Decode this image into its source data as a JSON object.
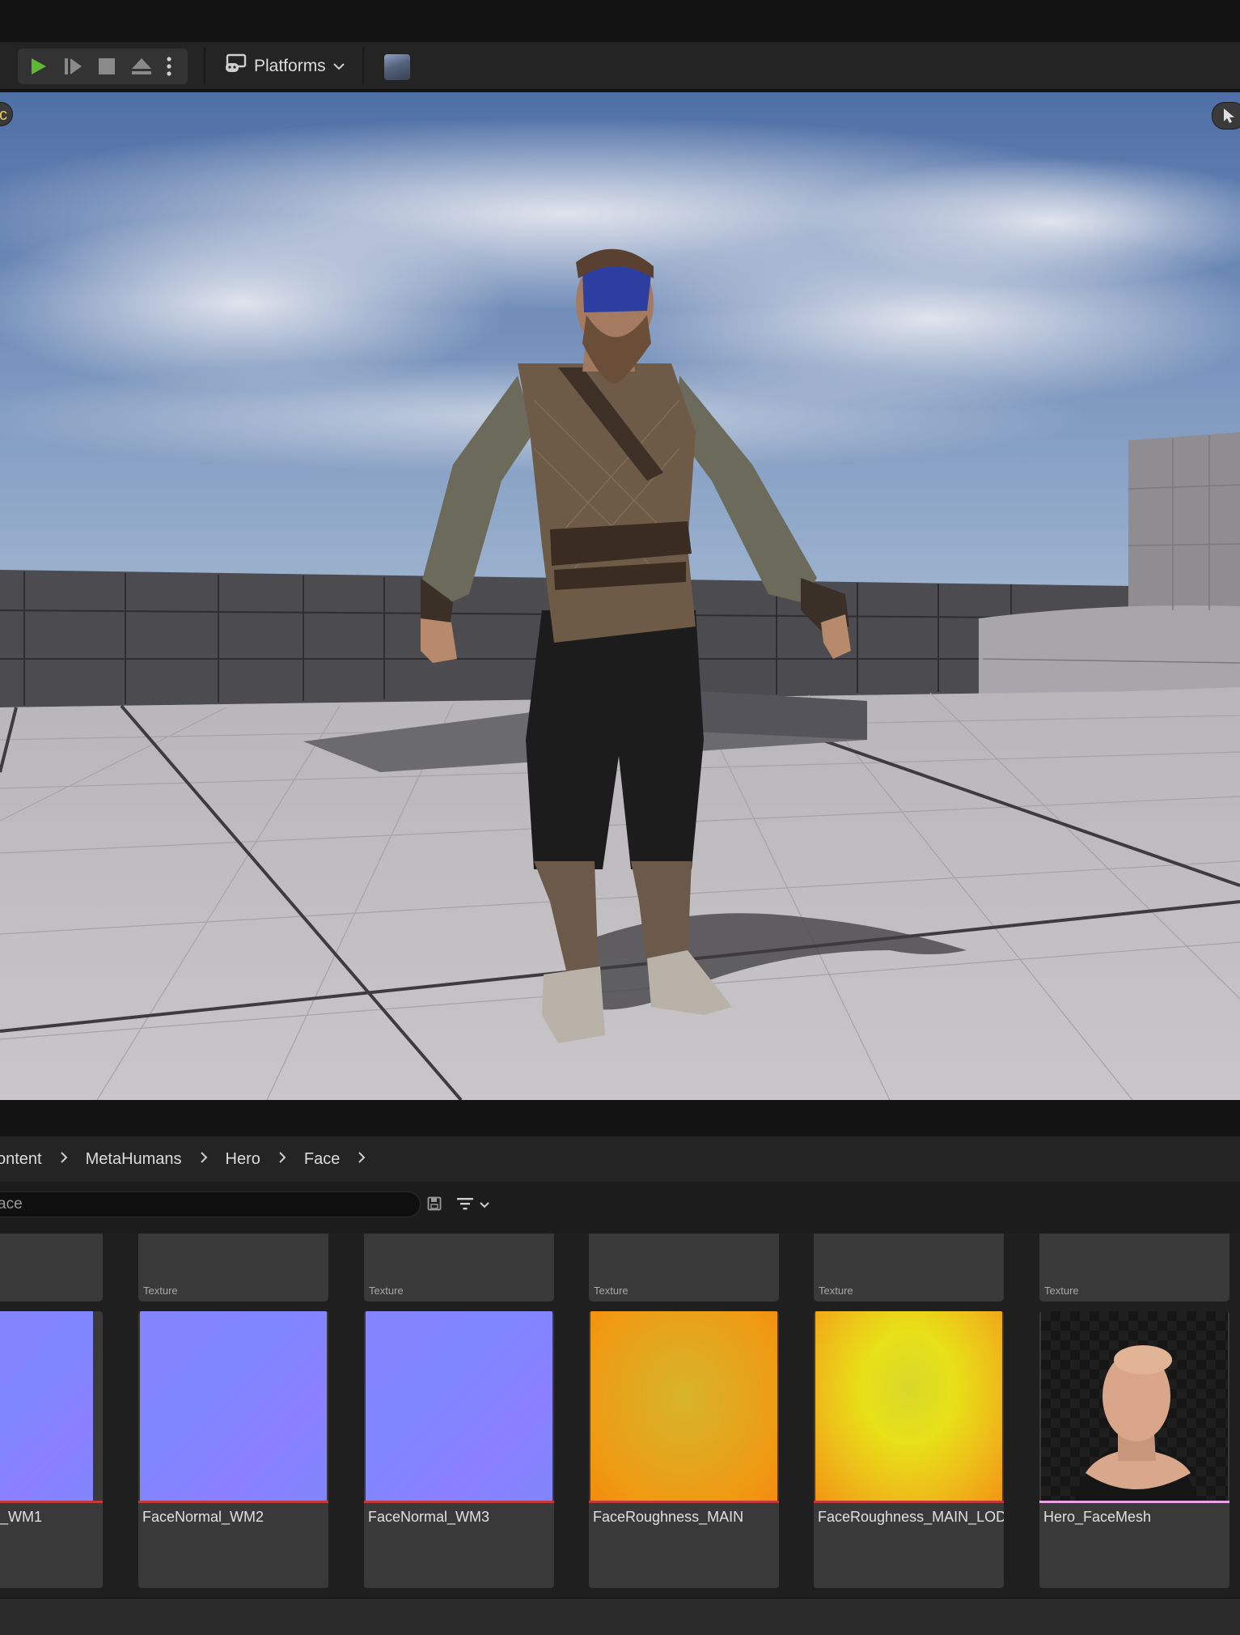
{
  "toolbar": {
    "platforms_label": "Platforms",
    "icons": [
      "play-icon",
      "step-icon",
      "stop-icon",
      "eject-icon",
      "more-vertical-icon",
      "gamepad-icon",
      "chevron-down-icon"
    ]
  },
  "viewport": {
    "left_badge": "c",
    "accent_color": "#e7c95a"
  },
  "breadcrumb": {
    "items": [
      "ontent",
      "MetaHumans",
      "Hero",
      "Face"
    ],
    "separator": "›"
  },
  "search": {
    "value": "ace"
  },
  "top_row_tiles": [
    {
      "type": ""
    },
    {
      "type": "Texture"
    },
    {
      "type": "Texture"
    },
    {
      "type": "Texture"
    },
    {
      "type": "Texture"
    },
    {
      "type": "Texture"
    }
  ],
  "assets": [
    {
      "name": "_WM1",
      "bar_color": "#c03a3a"
    },
    {
      "name": "FaceNormal_WM2",
      "bar_color": "#c03a3a"
    },
    {
      "name": "FaceNormal_WM3",
      "bar_color": "#c03a3a"
    },
    {
      "name": "FaceRoughness_MAIN",
      "bar_color": "#c03a3a"
    },
    {
      "name": "FaceRoughness_MAIN_LOD",
      "bar_color": "#c03a3a"
    },
    {
      "name": "Hero_FaceMesh",
      "bar_color": "#e8a0e8"
    }
  ]
}
